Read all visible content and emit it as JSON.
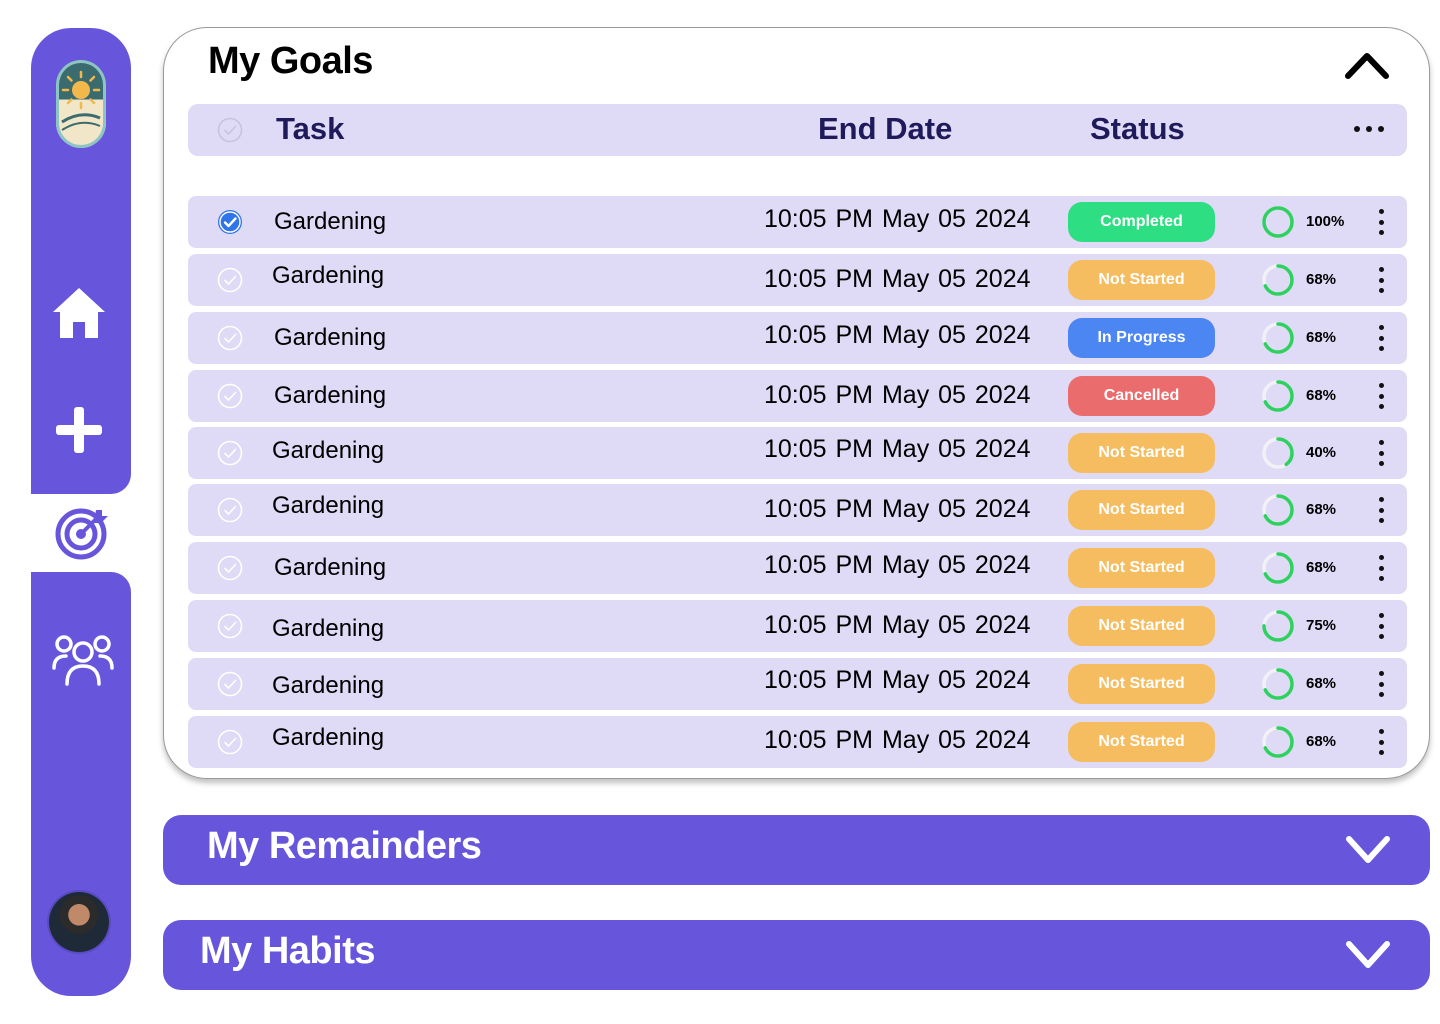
{
  "colors": {
    "accent": "#6756db",
    "row_bg": "#dfdaf5",
    "completed": "#2dde83",
    "not_started": "#f5bd5f",
    "in_progress": "#4b86f2",
    "cancelled": "#ea6c6c",
    "ring": "#2ed15f"
  },
  "sidebar": {
    "items": [
      {
        "name": "home",
        "icon": "home-icon"
      },
      {
        "name": "add",
        "icon": "plus-icon"
      },
      {
        "name": "goals",
        "icon": "target-icon",
        "active": true
      },
      {
        "name": "community",
        "icon": "users-icon"
      }
    ]
  },
  "goals": {
    "title": "My Goals",
    "headers": {
      "task": "Task",
      "end_date": "End Date",
      "status": "Status"
    },
    "rows": [
      {
        "task": "Gardening",
        "time": "10:05 PM",
        "date": "May 05 2024",
        "status": "Completed",
        "status_key": "completed",
        "progress": 100,
        "progress_label": "100%",
        "checked": true
      },
      {
        "task": "Gardening",
        "time": "10:05 PM",
        "date": "May 05 2024",
        "status": "Not Started",
        "status_key": "not_started",
        "progress": 68,
        "progress_label": "68%",
        "checked": false
      },
      {
        "task": "Gardening",
        "time": "10:05 PM",
        "date": "May 05 2024",
        "status": "In Progress",
        "status_key": "in_progress",
        "progress": 68,
        "progress_label": "68%",
        "checked": false
      },
      {
        "task": "Gardening",
        "time": "10:05 PM",
        "date": "May 05 2024",
        "status": "Cancelled",
        "status_key": "cancelled",
        "progress": 68,
        "progress_label": "68%",
        "checked": false
      },
      {
        "task": "Gardening",
        "time": "10:05 PM",
        "date": "May 05 2024",
        "status": "Not Started",
        "status_key": "not_started",
        "progress": 40,
        "progress_label": "40%",
        "checked": false
      },
      {
        "task": "Gardening",
        "time": "10:05 PM",
        "date": "May 05 2024",
        "status": "Not Started",
        "status_key": "not_started",
        "progress": 68,
        "progress_label": "68%",
        "checked": false
      },
      {
        "task": "Gardening",
        "time": "10:05 PM",
        "date": "May 05 2024",
        "status": "Not Started",
        "status_key": "not_started",
        "progress": 68,
        "progress_label": "68%",
        "checked": false
      },
      {
        "task": "Gardening",
        "time": "10:05 PM",
        "date": "May 05 2024",
        "status": "Not Started",
        "status_key": "not_started",
        "progress": 75,
        "progress_label": "75%",
        "checked": false
      },
      {
        "task": "Gardening",
        "time": "10:05 PM",
        "date": "May 05 2024",
        "status": "Not Started",
        "status_key": "not_started",
        "progress": 68,
        "progress_label": "68%",
        "checked": false
      },
      {
        "task": "Gardening",
        "time": "10:05 PM",
        "date": "May 05 2024",
        "status": "Not Started",
        "status_key": "not_started",
        "progress": 68,
        "progress_label": "68%",
        "checked": false
      }
    ]
  },
  "reminders": {
    "title": "My Remainders"
  },
  "habits": {
    "title": "My Habits"
  }
}
